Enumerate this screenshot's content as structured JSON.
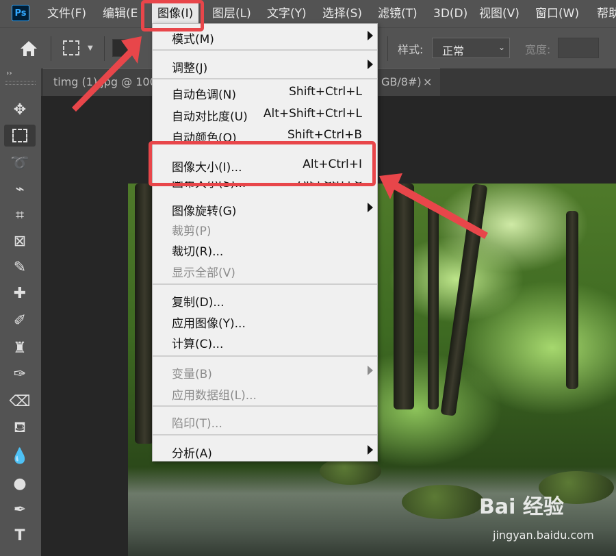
{
  "app": {
    "logo": "Ps"
  },
  "menubar": {
    "items": [
      "文件(F)",
      "编辑(E",
      "图像(I)",
      "图层(L)",
      "文字(Y)",
      "选择(S)",
      "滤镜(T)",
      "3D(D)",
      "视图(V)",
      "窗口(W)",
      "帮助"
    ]
  },
  "options": {
    "style_label": "样式:",
    "style_value": "正常",
    "width_label": "宽度:",
    "width_value": ""
  },
  "toolbar": {
    "collapse": "››"
  },
  "document": {
    "tab_title": "timg (1).jpg @ 100",
    "tab_title_tail": "GB/8#)",
    "close": "×"
  },
  "image_menu": {
    "items": [
      {
        "label": "模式(M)",
        "shortcut": "",
        "submenu": true,
        "disabled": false
      },
      {
        "label": "调整(J)",
        "shortcut": "",
        "submenu": true,
        "disabled": false
      },
      {
        "label": "自动色调(N)",
        "shortcut": "Shift+Ctrl+L",
        "submenu": false,
        "disabled": false
      },
      {
        "label": "自动对比度(U)",
        "shortcut": "Alt+Shift+Ctrl+L",
        "submenu": false,
        "disabled": false
      },
      {
        "label": "自动颜色(O)",
        "shortcut": "Shift+Ctrl+B",
        "submenu": false,
        "disabled": false
      },
      {
        "label": "图像大小(I)...",
        "shortcut": "Alt+Ctrl+I",
        "submenu": false,
        "disabled": false,
        "highlighted": true
      },
      {
        "label": "画布大小(S)...",
        "shortcut": "Alt+Ctrl+C",
        "submenu": false,
        "disabled": false
      },
      {
        "label": "图像旋转(G)",
        "shortcut": "",
        "submenu": true,
        "disabled": false
      },
      {
        "label": "裁剪(P)",
        "shortcut": "",
        "submenu": false,
        "disabled": true
      },
      {
        "label": "裁切(R)...",
        "shortcut": "",
        "submenu": false,
        "disabled": false
      },
      {
        "label": "显示全部(V)",
        "shortcut": "",
        "submenu": false,
        "disabled": true
      },
      {
        "label": "复制(D)...",
        "shortcut": "",
        "submenu": false,
        "disabled": false
      },
      {
        "label": "应用图像(Y)...",
        "shortcut": "",
        "submenu": false,
        "disabled": false
      },
      {
        "label": "计算(C)...",
        "shortcut": "",
        "submenu": false,
        "disabled": false
      },
      {
        "label": "变量(B)",
        "shortcut": "",
        "submenu": true,
        "disabled": true
      },
      {
        "label": "应用数据组(L)...",
        "shortcut": "",
        "submenu": false,
        "disabled": true
      },
      {
        "label": "陷印(T)...",
        "shortcut": "",
        "submenu": false,
        "disabled": true
      },
      {
        "label": "分析(A)",
        "shortcut": "",
        "submenu": true,
        "disabled": false
      }
    ]
  },
  "watermark": {
    "brand": "Bai 经验",
    "url": "jingyan.baidu.com"
  },
  "colors": {
    "annotation": "#e8464a",
    "menubar": "#535353",
    "menu_bg": "#f0f0f0"
  }
}
